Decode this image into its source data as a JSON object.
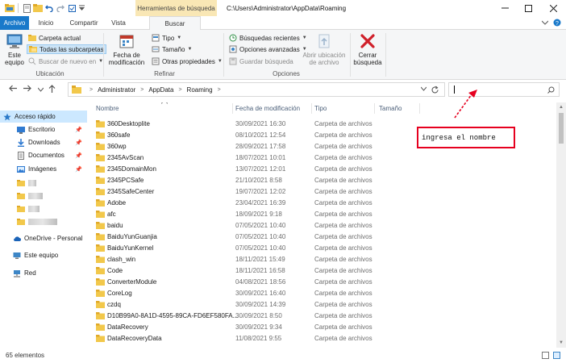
{
  "window": {
    "context_tab": "Herramientas de búsqueda",
    "title": "C:\\Users\\Administrator\\AppData\\Roaming"
  },
  "tabs": [
    "Archivo",
    "Inicio",
    "Compartir",
    "Vista",
    "Buscar"
  ],
  "ribbon": {
    "ubicacion": {
      "label": "Ubicación",
      "este_equipo": "Este equipo",
      "carpeta_actual": "Carpeta actual",
      "todas_subcarpetas": "Todas las subcarpetas",
      "buscar_nuevo": "Buscar de nuevo en"
    },
    "refinar": {
      "label": "Refinar",
      "fecha": "Fecha de modificación",
      "tipo": "Tipo",
      "tamano": "Tamaño",
      "otras": "Otras propiedades"
    },
    "opciones": {
      "label": "Opciones",
      "recientes": "Búsquedas recientes",
      "avanzadas": "Opciones avanzadas",
      "guardar": "Guardar búsqueda",
      "abrir_ubicacion": "Abrir ubicación de archivo"
    },
    "cerrar": "Cerrar búsqueda"
  },
  "breadcrumb": [
    "Administrator",
    "AppData",
    "Roaming"
  ],
  "search": {
    "value": ""
  },
  "nav": {
    "acceso_rapido": "Acceso rápido",
    "pinned": [
      "Escritorio",
      "Downloads",
      "Documentos",
      "Imágenes"
    ],
    "onedrive": "OneDrive - Personal",
    "este_equipo": "Este equipo",
    "red": "Red"
  },
  "columns": {
    "name": "Nombre",
    "date": "Fecha de modificación",
    "type": "Tipo",
    "size": "Tamaño"
  },
  "files": [
    {
      "name": "360Desktoplite",
      "date": "30/09/2021 16:30",
      "type": "Carpeta de archivos"
    },
    {
      "name": "360safe",
      "date": "08/10/2021 12:54",
      "type": "Carpeta de archivos"
    },
    {
      "name": "360wp",
      "date": "28/09/2021 17:58",
      "type": "Carpeta de archivos"
    },
    {
      "name": "2345AvScan",
      "date": "18/07/2021 10:01",
      "type": "Carpeta de archivos"
    },
    {
      "name": "2345DomainMon",
      "date": "13/07/2021 12:01",
      "type": "Carpeta de archivos"
    },
    {
      "name": "2345PCSafe",
      "date": "21/10/2021 8:58",
      "type": "Carpeta de archivos"
    },
    {
      "name": "2345SafeCenter",
      "date": "19/07/2021 12:02",
      "type": "Carpeta de archivos"
    },
    {
      "name": "Adobe",
      "date": "23/04/2021 16:39",
      "type": "Carpeta de archivos"
    },
    {
      "name": "afc",
      "date": "18/09/2021 9:18",
      "type": "Carpeta de archivos"
    },
    {
      "name": "baidu",
      "date": "07/05/2021 10:40",
      "type": "Carpeta de archivos"
    },
    {
      "name": "BaiduYunGuanjia",
      "date": "07/05/2021 10:40",
      "type": "Carpeta de archivos"
    },
    {
      "name": "BaiduYunKernel",
      "date": "07/05/2021 10:40",
      "type": "Carpeta de archivos"
    },
    {
      "name": "clash_win",
      "date": "18/11/2021 15:49",
      "type": "Carpeta de archivos"
    },
    {
      "name": "Code",
      "date": "18/11/2021 16:58",
      "type": "Carpeta de archivos"
    },
    {
      "name": "ConverterModule",
      "date": "04/08/2021 18:56",
      "type": "Carpeta de archivos"
    },
    {
      "name": "CoreLog",
      "date": "30/09/2021 16:40",
      "type": "Carpeta de archivos"
    },
    {
      "name": "czdq",
      "date": "30/09/2021 14:39",
      "type": "Carpeta de archivos"
    },
    {
      "name": "D10B99A0-8A1D-4595-89CA-FD6EF580FA...",
      "date": "30/09/2021 8:50",
      "type": "Carpeta de archivos"
    },
    {
      "name": "DataRecovery",
      "date": "30/09/2021 9:34",
      "type": "Carpeta de archivos"
    },
    {
      "name": "DataRecoveryData",
      "date": "11/08/2021 9:55",
      "type": "Carpeta de archivos"
    }
  ],
  "status": {
    "count": "65 elementos"
  },
  "annotation": {
    "text": "ingresa el nombre",
    "color": "#e6001f"
  },
  "colors": {
    "accent": "#1979ca",
    "folder": "#f2c84b",
    "selection": "#cce8ff"
  }
}
